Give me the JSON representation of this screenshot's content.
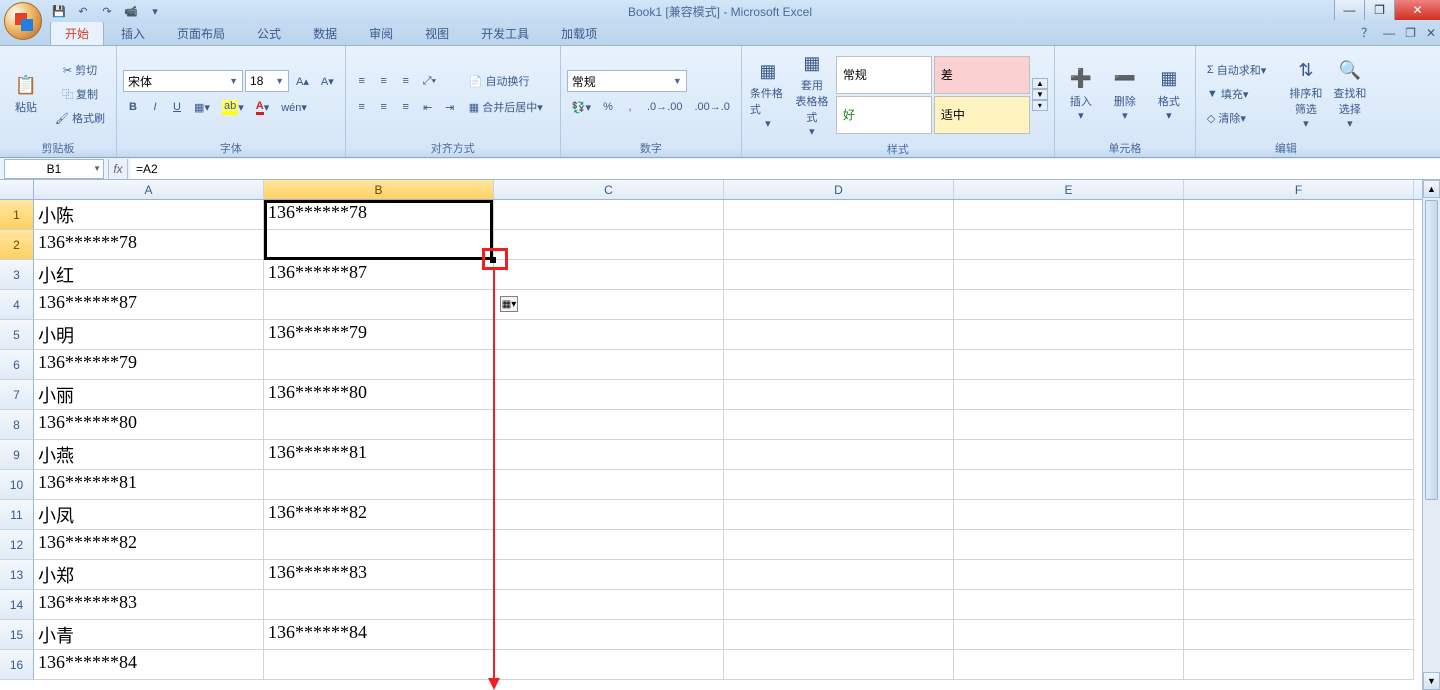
{
  "title": "Book1 [兼容模式] - Microsoft Excel",
  "qat": {
    "save": "💾",
    "undo": "↶",
    "redo": "↷",
    "print": "📹",
    "more": "▾"
  },
  "tabs": [
    "开始",
    "插入",
    "页面布局",
    "公式",
    "数据",
    "审阅",
    "视图",
    "开发工具",
    "加载项"
  ],
  "active_tab": 0,
  "ribbon_help": "？",
  "clipboard": {
    "paste": "粘贴",
    "cut": "剪切",
    "copy": "复制",
    "painter": "格式刷",
    "label": "剪贴板"
  },
  "font": {
    "name": "宋体",
    "size": "18",
    "bold": "B",
    "italic": "I",
    "underline": "U",
    "label": "字体"
  },
  "align": {
    "wrap": "自动换行",
    "merge": "合并后居中",
    "label": "对齐方式"
  },
  "number": {
    "format": "常规",
    "label": "数字"
  },
  "styles": {
    "cond": "条件格式",
    "table": "套用\n表格格式",
    "label": "样式",
    "cells": [
      [
        "常规",
        "差"
      ],
      [
        "好",
        "适中"
      ]
    ]
  },
  "cellsg": {
    "insert": "插入",
    "delete": "删除",
    "format": "格式",
    "label": "单元格"
  },
  "editing": {
    "sum": "自动求和",
    "fill": "填充",
    "clear": "清除",
    "sort": "排序和\n筛选",
    "find": "查找和\n选择",
    "label": "编辑"
  },
  "namebox": "B1",
  "formula": "=A2",
  "columns": [
    "A",
    "B",
    "C",
    "D",
    "E",
    "F"
  ],
  "rows": [
    {
      "n": "1",
      "A": "小陈",
      "B": "136******78"
    },
    {
      "n": "2",
      "A": "136******78",
      "B": ""
    },
    {
      "n": "3",
      "A": "小红",
      "B": "136******87"
    },
    {
      "n": "4",
      "A": "136******87",
      "B": ""
    },
    {
      "n": "5",
      "A": "小明",
      "B": "136******79"
    },
    {
      "n": "6",
      "A": "136******79",
      "B": ""
    },
    {
      "n": "7",
      "A": "小丽",
      "B": "136******80"
    },
    {
      "n": "8",
      "A": "136******80",
      "B": ""
    },
    {
      "n": "9",
      "A": "小燕",
      "B": "136******81"
    },
    {
      "n": "10",
      "A": "136******81",
      "B": ""
    },
    {
      "n": "11",
      "A": "小凤",
      "B": "136******82"
    },
    {
      "n": "12",
      "A": "136******82",
      "B": ""
    },
    {
      "n": "13",
      "A": "小郑",
      "B": "136******83"
    },
    {
      "n": "14",
      "A": "136******83",
      "B": ""
    },
    {
      "n": "15",
      "A": "小青",
      "B": "136******84"
    },
    {
      "n": "16",
      "A": "136******84",
      "B": ""
    }
  ],
  "selected_range": "B1:B2"
}
